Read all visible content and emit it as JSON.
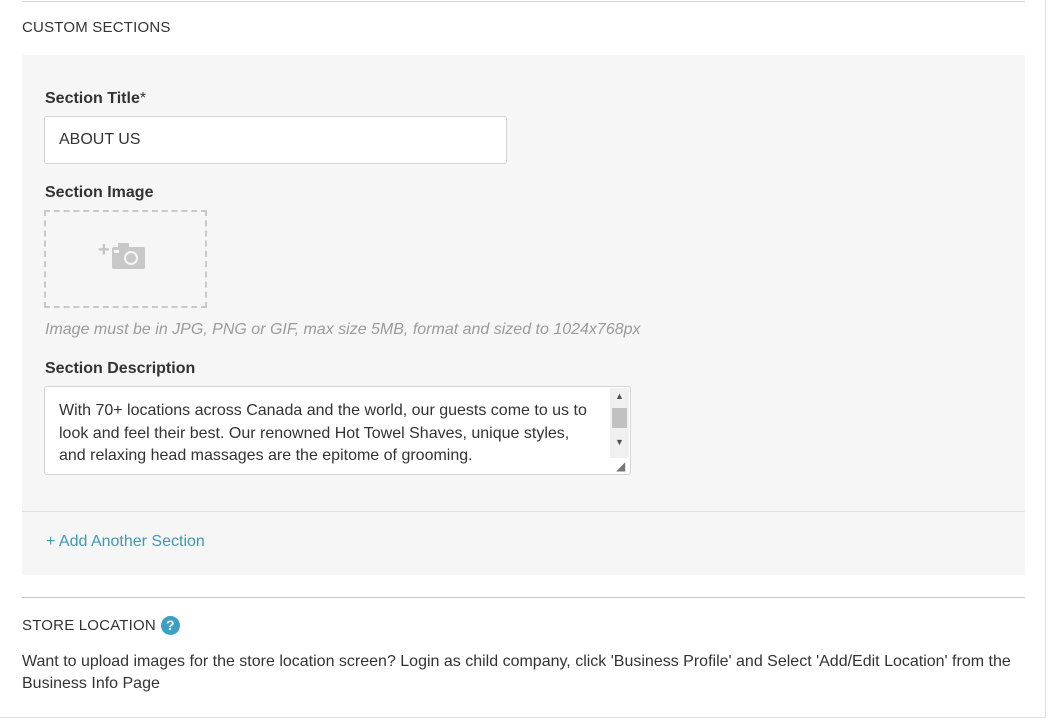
{
  "custom_sections": {
    "heading": "CUSTOM SECTIONS",
    "section_title_label": "Section Title",
    "required_mark": "*",
    "section_title_value": "ABOUT US",
    "section_image_label": "Section Image",
    "image_hint": "Image must be in JPG, PNG or GIF, max size 5MB, format and sized to 1024x768px",
    "section_description_label": "Section Description",
    "section_description_value": "With 70+ locations across Canada and the world, our guests come to us to look and feel their best. Our renowned Hot Towel Shaves, unique styles, and relaxing head massages are the epitome of grooming.",
    "add_section_link": "+ Add Another Section"
  },
  "store_location": {
    "heading": "STORE LOCATION",
    "help_icon": "?",
    "text": "Want to upload images for the store location screen? Login as child company, click 'Business Profile' and Select 'Add/Edit Location' from the Business Info Page"
  },
  "icons": {
    "add_photo": "add-photo-icon",
    "help": "help-icon"
  },
  "colors": {
    "link": "#3d9bb0",
    "help_badge": "#3aa0c4",
    "panel_background": "#f6f6f6",
    "hint_text": "#9b9b9b"
  }
}
